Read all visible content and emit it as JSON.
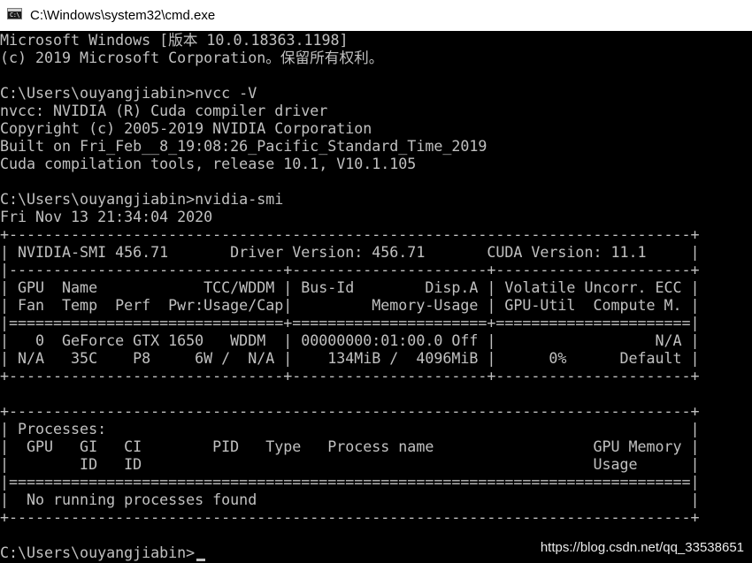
{
  "window": {
    "title": "C:\\Windows\\system32\\cmd.exe",
    "icon": "cmd-icon",
    "icon_text": "C:\\"
  },
  "console": {
    "lines": [
      "Microsoft Windows [版本 10.0.18363.1198]",
      "(c) 2019 Microsoft Corporation。保留所有权利。",
      "",
      "C:\\Users\\ouyangjiabin>nvcc -V",
      "nvcc: NVIDIA (R) Cuda compiler driver",
      "Copyright (c) 2005-2019 NVIDIA Corporation",
      "Built on Fri_Feb__8_19:08:26_Pacific_Standard_Time_2019",
      "Cuda compilation tools, release 10.1, V10.1.105",
      "",
      "C:\\Users\\ouyangjiabin>nvidia-smi",
      "Fri Nov 13 21:34:04 2020",
      "+-----------------------------------------------------------------------------+",
      "| NVIDIA-SMI 456.71       Driver Version: 456.71       CUDA Version: 11.1     |",
      "|-------------------------------+----------------------+----------------------+",
      "| GPU  Name            TCC/WDDM | Bus-Id        Disp.A | Volatile Uncorr. ECC |",
      "| Fan  Temp  Perf  Pwr:Usage/Cap|         Memory-Usage | GPU-Util  Compute M. |",
      "|===============================+======================+======================|",
      "|   0  GeForce GTX 1650   WDDM  | 00000000:01:00.0 Off |                  N/A |",
      "| N/A   35C    P8     6W /  N/A |    134MiB /  4096MiB |      0%      Default |",
      "+-------------------------------+----------------------+----------------------+",
      "",
      "+-----------------------------------------------------------------------------+",
      "| Processes:                                                                  |",
      "|  GPU   GI   CI        PID   Type   Process name                  GPU Memory |",
      "|        ID   ID                                                   Usage      |",
      "|=============================================================================|",
      "|  No running processes found                                                 |",
      "+-----------------------------------------------------------------------------+",
      ""
    ],
    "prompt": "C:\\Users\\ouyangjiabin>",
    "input": ""
  },
  "watermark": "https://blog.csdn.net/qq_33538651",
  "colors": {
    "background": "#000000",
    "foreground": "#c0c0c0",
    "titlebar": "#ffffff"
  }
}
